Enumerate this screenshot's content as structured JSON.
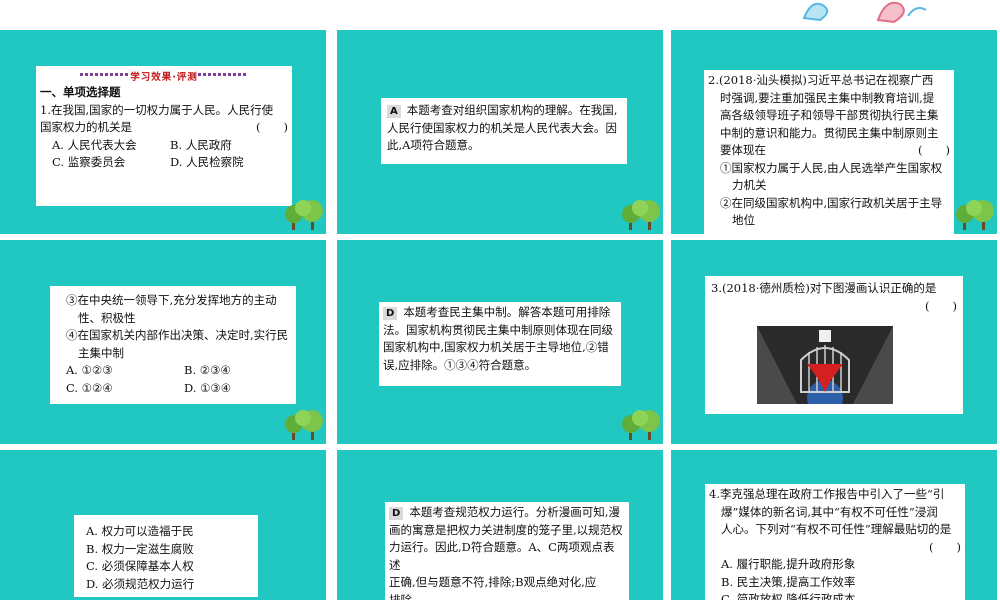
{
  "colors": {
    "slide_bg": "#21c7c1",
    "card_bg": "#ffffff",
    "header_red": "#c01818"
  },
  "s1": {
    "header": "学习效果·评测",
    "section": "一、单项选择题",
    "q1_line1": "1.在我国,国家的一切权力属于人民。人民行使",
    "q1_line2": "国家权力的机关是",
    "paren": "(　　)",
    "optA": "A. 人民代表大会",
    "optB": "B. 人民政府",
    "optC": "C. 监察委员会",
    "optD": "D. 人民检察院"
  },
  "s2": {
    "answer": "A",
    "line1": "本题考查对组织国家机构的理解。在我国,",
    "line2": "人民行使国家权力的机关是人民代表大会。因",
    "line3": "此,A项符合题意。"
  },
  "s3": {
    "line1": "2.(2018·汕头模拟)习近平总书记在视察广西",
    "line2": "时强调,要注重加强民主集中制教育培训,提",
    "line3": "高各级领导班子和领导干部贯彻执行民主集",
    "line4": "中制的意识和能力。贯彻民主集中制原则主",
    "line5": "要体现在",
    "paren": "(　　)",
    "item1a": "①国家权力属于人民,由人民选举产生国家权",
    "item1b": "力机关",
    "item2a": "②在同级国家机构中,国家行政机关居于主导",
    "item2b": "地位"
  },
  "s4": {
    "item3a": "③在中央统一领导下,充分发挥地方的主动",
    "item3b": "性、积极性",
    "item4a": "④在国家机关内部作出决策、决定时,实行民",
    "item4b": "主集中制",
    "optA": "A. ①②③",
    "optB": "B. ②③④",
    "optC": "C. ①②④",
    "optD": "D. ①③④"
  },
  "s5": {
    "answer": "D",
    "line1": "本题考查民主集中制。解答本题可用排除",
    "line2": "法。国家机构贯彻民主集中制原则体现在同级",
    "line3": "国家机构中,国家权力机关居于主导地位,②错",
    "line4": "误,应排除。①③④符合题意。"
  },
  "s6": {
    "line1": "3.(2018·德州质检)对下图漫画认识正确的是",
    "paren": "(　　)"
  },
  "s7": {
    "optA": "A. 权力可以造福于民",
    "optB": "B. 权力一定滋生腐败",
    "optC": "C. 必须保障基本人权",
    "optD": "D. 必须规范权力运行"
  },
  "s8": {
    "answer": "D",
    "line1": "本题考查规范权力运行。分析漫画可知,漫",
    "line2": "画的寓意是把权力关进制度的笼子里,以规范权",
    "line3": "力运行。因此,D符合题意。A、C两项观点表述",
    "line4": "正确,但与题意不符,排除;B观点绝对化,应",
    "line5": "排除。"
  },
  "s9": {
    "line1": "4.李克强总理在政府工作报告中引入了一些“引",
    "line2": "爆”媒体的新名词,其中“有权不可任性”浸润",
    "line3": "人心。下列对“有权不可任性”理解最贴切的是",
    "paren": "(　　)",
    "optA": "A. 履行职能,提升政府形象",
    "optB": "B. 民主决策,提高工作效率",
    "optC": "C. 简政放权,降低行政成本"
  }
}
